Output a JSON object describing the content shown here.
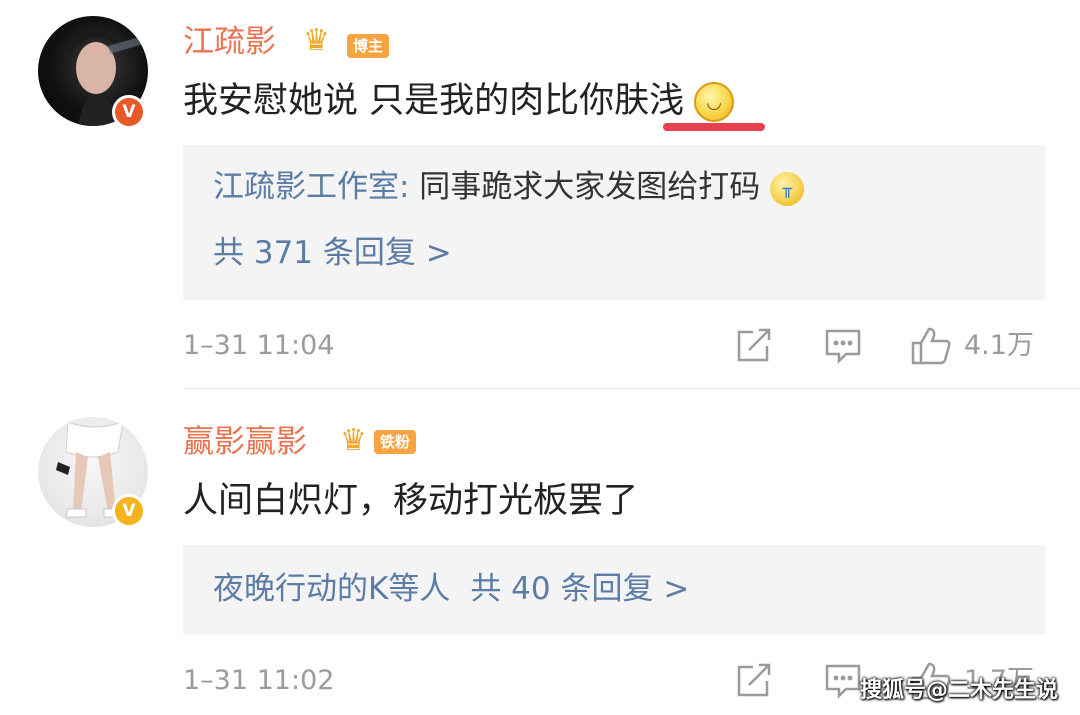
{
  "comments": [
    {
      "username": "江疏影",
      "badge": "博主",
      "text_main": "我安慰她说 只是我的肉比你",
      "text_marked": "肤浅",
      "reply": {
        "author": "江疏影工作室:",
        "text": " 同事跪求大家发图给打码",
        "more": "共 371 条回复 >"
      },
      "time": "1–31 11:04",
      "likes": "4.1万"
    },
    {
      "username": "赢影赢影",
      "badge": "铁粉",
      "text_main": "人间白炽灯，移动打光板罢了",
      "reply": {
        "author": "夜晚行动的K等人",
        "more": "共 40 条回复 >"
      },
      "time": "1–31 11:02",
      "likes": "1.7万"
    }
  ],
  "watermark": "搜狐号@二木先生说",
  "icons": {
    "verified": "verified-v-icon",
    "crown": "crown-icon",
    "share": "share-icon",
    "comment": "comment-icon",
    "like": "thumbs-up-icon",
    "smile": "smile-emoji-icon",
    "cry": "crying-emoji-icon"
  },
  "colors": {
    "username": "#eb7350",
    "link": "#5b7ca6",
    "meta": "#9b9b9b",
    "reply_bg": "#f4f4f4",
    "mark": "#e8414e"
  }
}
